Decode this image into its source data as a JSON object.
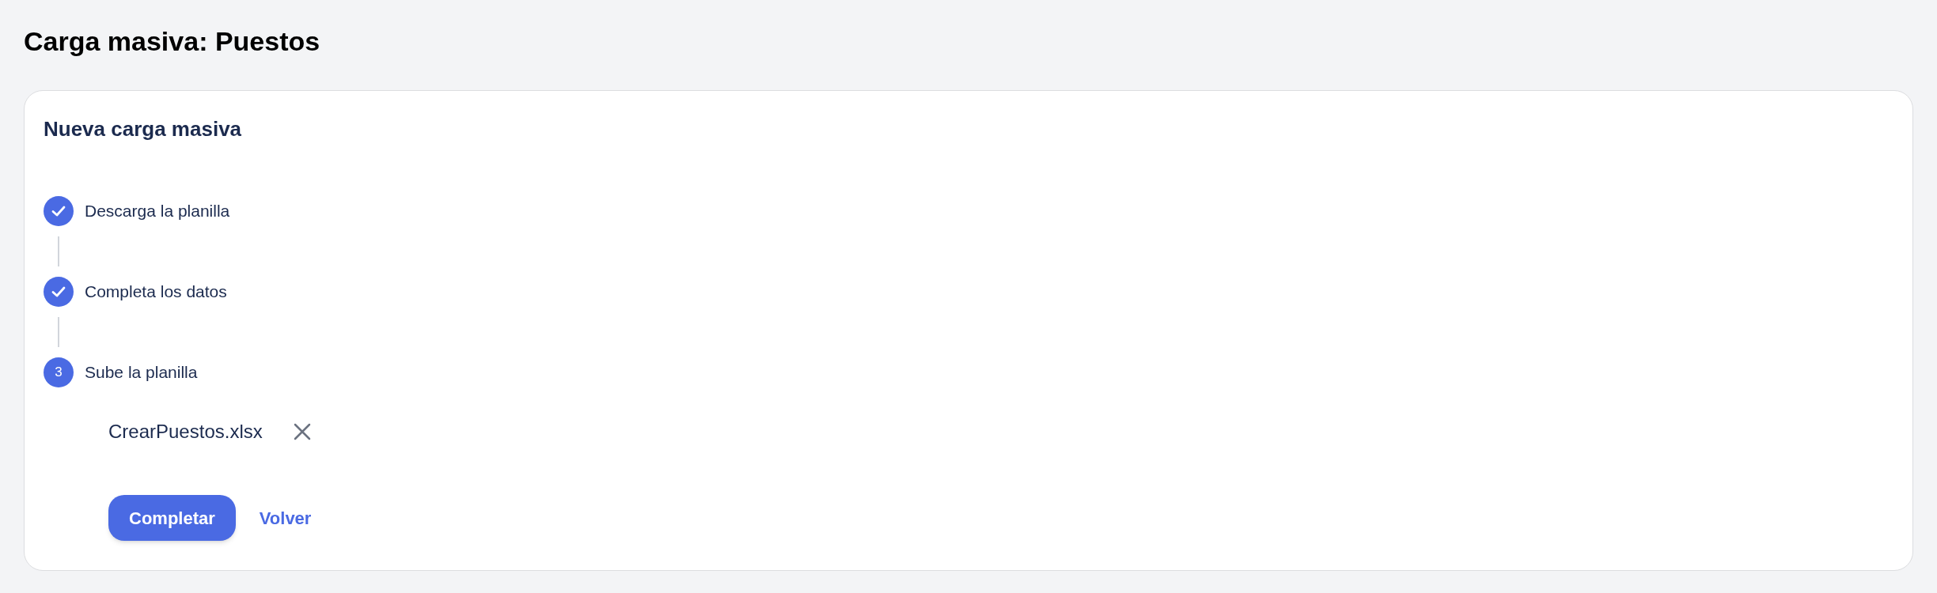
{
  "page_title": "Carga masiva: Puestos",
  "card": {
    "title": "Nueva carga masiva",
    "steps": [
      {
        "label": "Descarga la planilla",
        "completed": true
      },
      {
        "label": "Completa los datos",
        "completed": true
      },
      {
        "label": "Sube la planilla",
        "completed": false,
        "number": "3"
      }
    ],
    "file": {
      "name": "CrearPuestos.xlsx"
    },
    "primary_button": "Completar",
    "back_link": "Volver"
  }
}
